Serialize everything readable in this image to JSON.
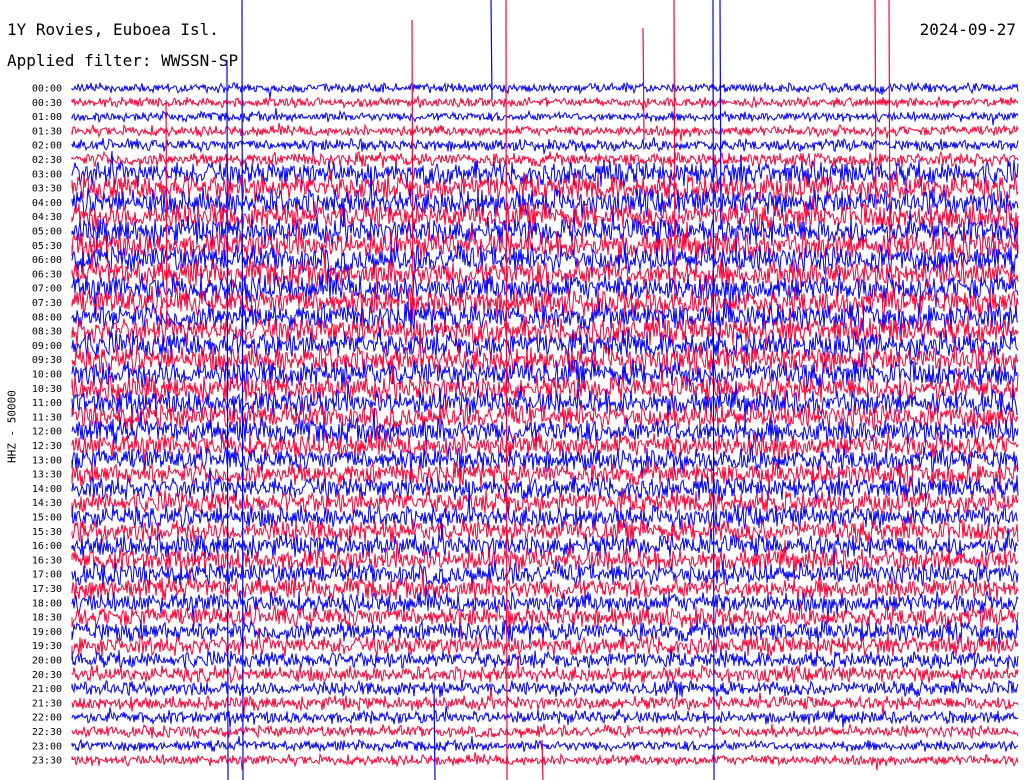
{
  "header": {
    "station": "1Y Rovies, Euboea Isl.",
    "filter": "Applied filter: WWSSN-SP",
    "date": "2024-09-27"
  },
  "chart_data": {
    "type": "helicorder",
    "ylabel": "HHZ - 50000",
    "row_times": [
      "00:00",
      "00:30",
      "01:00",
      "01:30",
      "02:00",
      "02:30",
      "03:00",
      "03:30",
      "04:00",
      "04:30",
      "05:00",
      "05:30",
      "06:00",
      "06:30",
      "07:00",
      "07:30",
      "08:00",
      "08:30",
      "09:00",
      "09:30",
      "10:00",
      "10:30",
      "11:00",
      "11:30",
      "12:00",
      "12:30",
      "13:00",
      "13:30",
      "14:00",
      "14:30",
      "15:00",
      "15:30",
      "16:00",
      "16:30",
      "17:00",
      "17:30",
      "18:00",
      "18:30",
      "19:00",
      "19:30",
      "20:00",
      "20:30",
      "21:00",
      "21:30",
      "22:00",
      "22:30",
      "23:00",
      "23:30"
    ],
    "colors": [
      "#0000ff",
      "#ff0033"
    ],
    "noise_level": [
      0.2,
      0.2,
      0.2,
      0.25,
      0.3,
      0.4,
      0.9,
      1.0,
      1.0,
      1.0,
      1.0,
      1.0,
      1.0,
      1.0,
      1.0,
      1.0,
      1.0,
      1.0,
      1.0,
      1.0,
      1.0,
      0.95,
      0.9,
      0.9,
      0.9,
      0.85,
      0.8,
      0.8,
      0.8,
      0.8,
      0.8,
      0.8,
      0.8,
      0.8,
      0.75,
      0.75,
      0.7,
      0.7,
      0.7,
      0.65,
      0.55,
      0.5,
      0.45,
      0.4,
      0.35,
      0.3,
      0.25,
      0.25
    ]
  }
}
